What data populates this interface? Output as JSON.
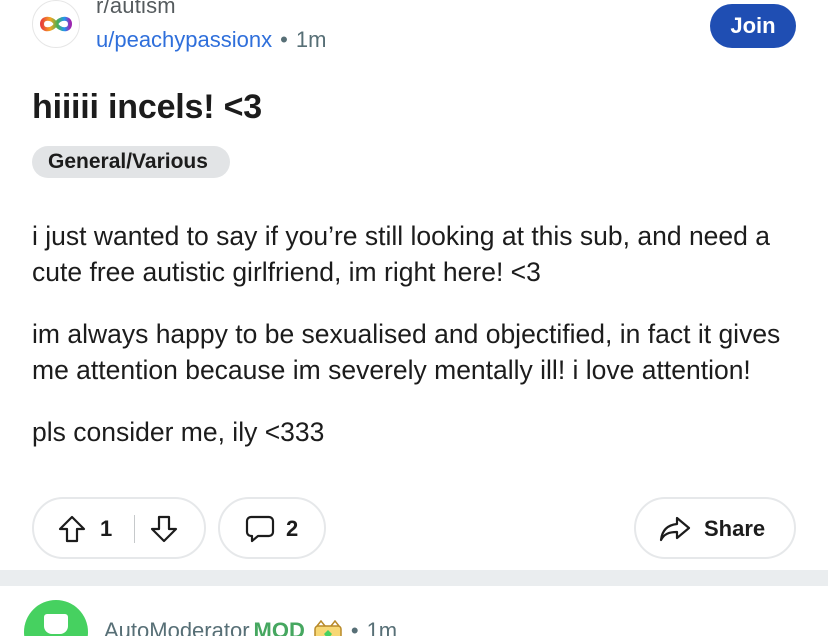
{
  "post": {
    "subreddit": "r/autism",
    "author": "u/peachypassionx",
    "separator_dot": "•",
    "time": "1m",
    "join_label": "Join",
    "title": "hiiiii incels! <3",
    "flair": "General/Various",
    "body": [
      "i just wanted to say if you’re still looking at this sub, and need a cute free autistic girlfriend, im right here! <3",
      "im always happy to be sexualised and objectified, in fact it gives me attention because im severely mentally ill! i love attention!",
      "pls consider me, ily <333"
    ],
    "upvotes": "1",
    "comments": "2",
    "share_label": "Share",
    "icons": {
      "subreddit": "infinity-icon",
      "upvote": "arrow-up-icon",
      "downvote": "arrow-down-icon",
      "comment": "speech-bubble-icon",
      "share": "share-arrow-icon"
    }
  },
  "comment": {
    "author": "AutoModerator",
    "mod_tag": "MOD",
    "separator_dot": "•",
    "time": "1m"
  },
  "colors": {
    "join_button": "#1f4eb3",
    "author_link": "#2f6fdb",
    "mod_green": "#46d160",
    "flair_bg": "#e2e4e6",
    "separator": "#eaedef"
  }
}
